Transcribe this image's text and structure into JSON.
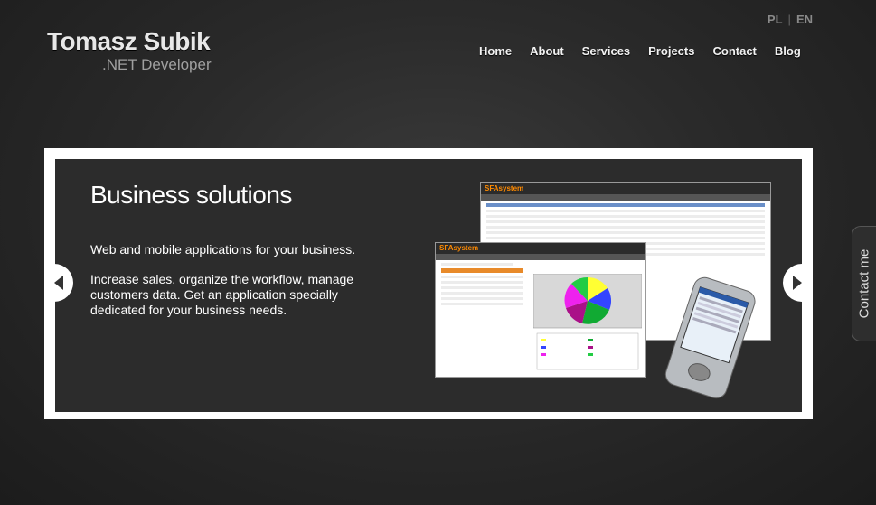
{
  "logo": {
    "name": "Tomasz Subik",
    "role": ".NET Developer"
  },
  "languages": [
    "PL",
    "EN"
  ],
  "nav": [
    "Home",
    "About",
    "Services",
    "Projects",
    "Contact",
    "Blog"
  ],
  "slide": {
    "title": "Business solutions",
    "paragraphs": [
      "Web and mobile applications for your business.",
      "Increase sales, organize the workflow, manage customers data. Get an application specially dedicated for your business needs."
    ],
    "app_brand": "SFAsystem"
  },
  "contact_tab": "Contact me",
  "colors": {
    "background": "#2a2a2a",
    "accent_orange": "#ff8a00",
    "frame": "#ffffff"
  },
  "icons": {
    "prev": "triangle-left-icon",
    "next": "triangle-right-icon"
  }
}
